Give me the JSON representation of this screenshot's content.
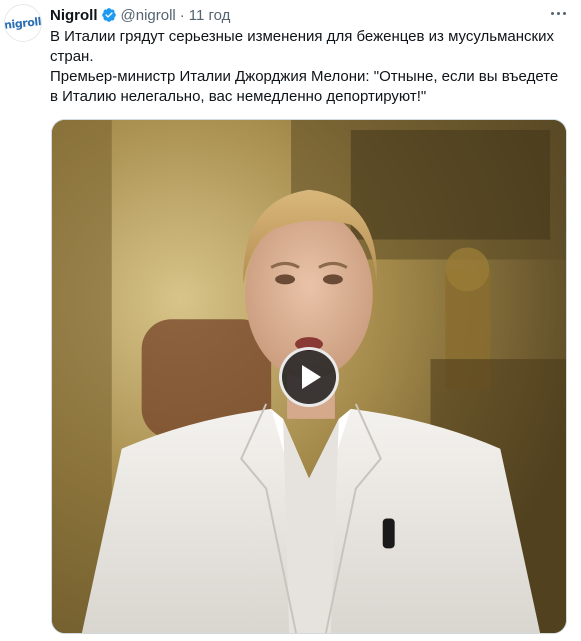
{
  "tweet": {
    "avatar_text": "nigroll",
    "author_name": "Nigroll",
    "verified_icon": "verified-badge-icon",
    "handle": "@nigroll",
    "separator": "·",
    "time": "11 год",
    "more_icon": "more-dots-icon",
    "text_lines": [
      "В Италии грядут серьезные изменения для беженцев из мусульманских стран.",
      "Премьер-министр Италии Джорджия Мелони: \"Отныне, если вы въедете в Италию нелегально, вас немедленно депортируют!\""
    ],
    "media": {
      "type": "video",
      "play_icon": "play-icon"
    }
  },
  "colors": {
    "text_primary": "#0f1419",
    "text_secondary": "#536471",
    "verified": "#1d9bf0",
    "avatar_text": "#2a6fb3"
  }
}
